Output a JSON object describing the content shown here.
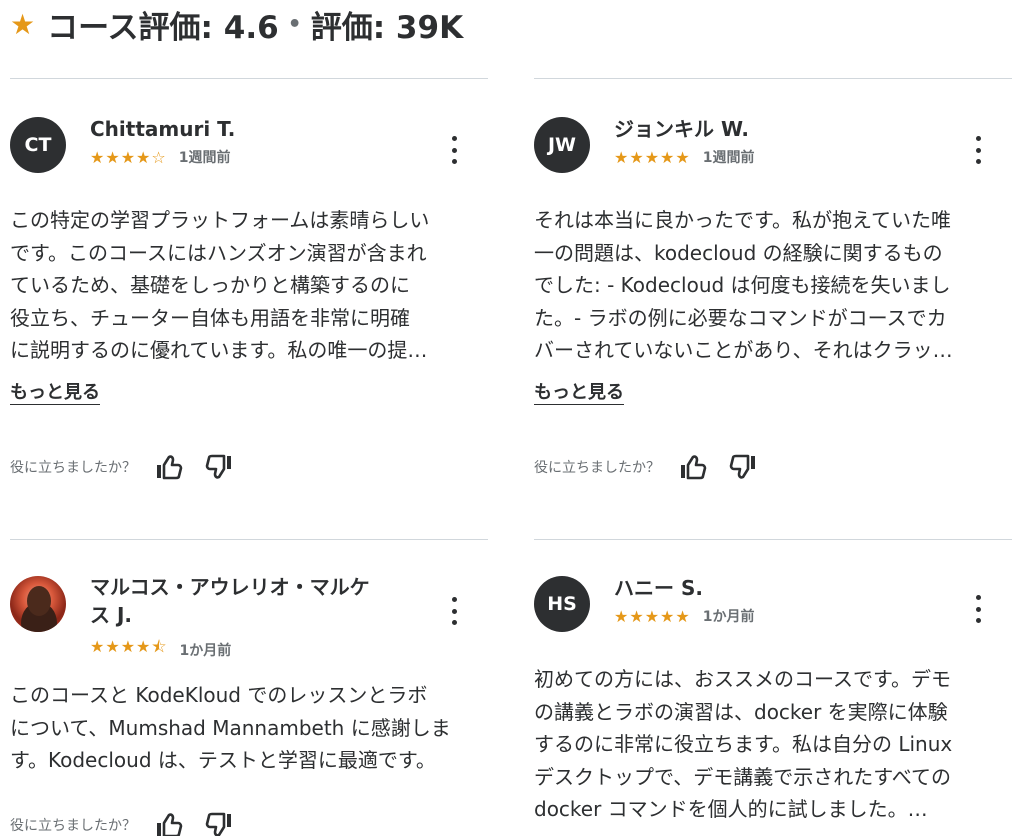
{
  "header": {
    "star_glyph": "★",
    "rating_label": "コース評価: 4.6",
    "separator": "•",
    "count_label": "評価: 39K"
  },
  "colors": {
    "star": "#e59819",
    "text": "#2d2f31",
    "muted": "#6a6f73",
    "divider": "#d1d7dc"
  },
  "reviews": [
    {
      "initials": "CT",
      "name": "Chittamuri T.",
      "rating": 4,
      "stars": "★★★★☆",
      "time": "1週間前",
      "text": "この特定の学習プラットフォームは素晴らしい\nです。このコースにはハンズオン演習が含まれ\nているため、基礎をしっかりと構築するのに\n役立ち、チューター自体も用語を非常に明確\nに説明するのに優れています。私の唯一の提…",
      "more_label": "もっと見る",
      "helpful_label": "役に立ちましたか？"
    },
    {
      "initials": "JW",
      "name": "ジョンキル W.",
      "rating": 5,
      "stars": "★★★★★",
      "time": "1週間前",
      "text": "それは本当に良かったです。私が抱えていた唯\n一の問題は、kodecloud の経験に関するもの\nでした: - Kodecloud は何度も接続を失いまし\nた。- ラボの例に必要なコマンドがコースでカ\nバーされていないことがあり、それはクラッ…",
      "more_label": "もっと見る",
      "helpful_label": "役に立ちましたか？"
    },
    {
      "initials": "",
      "name": "マルコス・アウレリオ・マルケ\nス J.",
      "rating": 4.5,
      "stars": "★★★★⯪",
      "time": "1か月前",
      "text": "このコースと KodeKloud でのレッスンとラボ\nについて、Mumshad Mannambeth に感謝しま\nす。Kodecloud は、テストと学習に最適です。",
      "helpful_label": "役に立ちましたか？"
    },
    {
      "initials": "HS",
      "name": "ハニー S.",
      "rating": 5,
      "stars": "★★★★★",
      "time": "1か月前",
      "text": "初めての方には、おススメのコースです。デモ\nの講義とラボの演習は、docker を実際に体験\nするのに非常に役立ちます。私は自分の Linux\nデスクトップで、デモ講義で示されたすべての\ndocker コマンドを個人的に試しました。…"
    }
  ]
}
